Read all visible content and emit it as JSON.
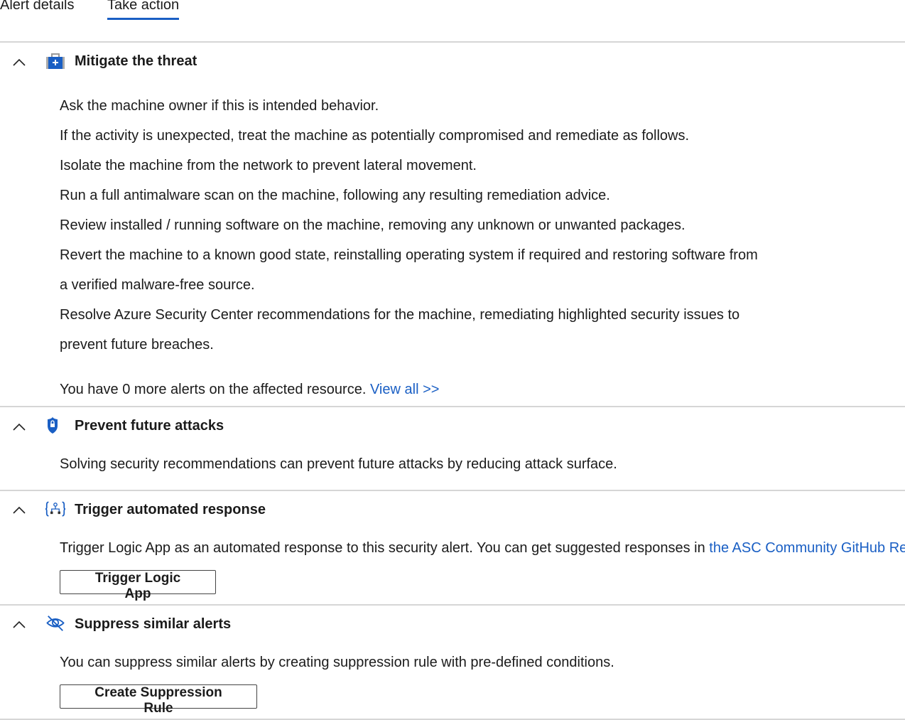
{
  "tabs": [
    {
      "label": "Alert details"
    },
    {
      "label": "Take action"
    }
  ],
  "sections": [
    {
      "title": "Mitigate the threat",
      "icon": "toolbox-icon",
      "lines": [
        "Ask the machine owner if this is intended behavior.",
        "If the activity is unexpected, treat the machine as potentially compromised and remediate as follows.",
        "Isolate the machine from the network to prevent lateral movement.",
        "Run a full antimalware scan on the machine, following any resulting remediation advice.",
        "Review installed / running software on the machine, removing any unknown or unwanted packages.",
        "Revert the machine to a known good state, reinstalling operating system if required and restoring software from",
        "a verified malware-free source.",
        "Resolve Azure Security Center recommendations for the machine, remediating highlighted security issues to",
        "prevent future breaches."
      ],
      "alerts_text": "You have 0 more alerts on the affected resource.",
      "view_all": "View all >>"
    },
    {
      "title": "Prevent future attacks",
      "icon": "shield-lock-icon",
      "text": "Solving security recommendations can prevent future attacks by reducing attack surface."
    },
    {
      "title": "Trigger automated response",
      "icon": "logic-app-icon",
      "text": "Trigger Logic App as an automated response to this security alert. You can get suggested responses in",
      "link": "the ASC Community GitHub Repo.",
      "button": "Trigger Logic App"
    },
    {
      "title": "Suppress similar alerts",
      "icon": "eye-hidden-icon",
      "text": "You can suppress similar alerts by creating suppression rule with pre-defined conditions.",
      "button": "Create Suppression Rule"
    }
  ],
  "colors": {
    "accent": "#1a5fc4"
  }
}
